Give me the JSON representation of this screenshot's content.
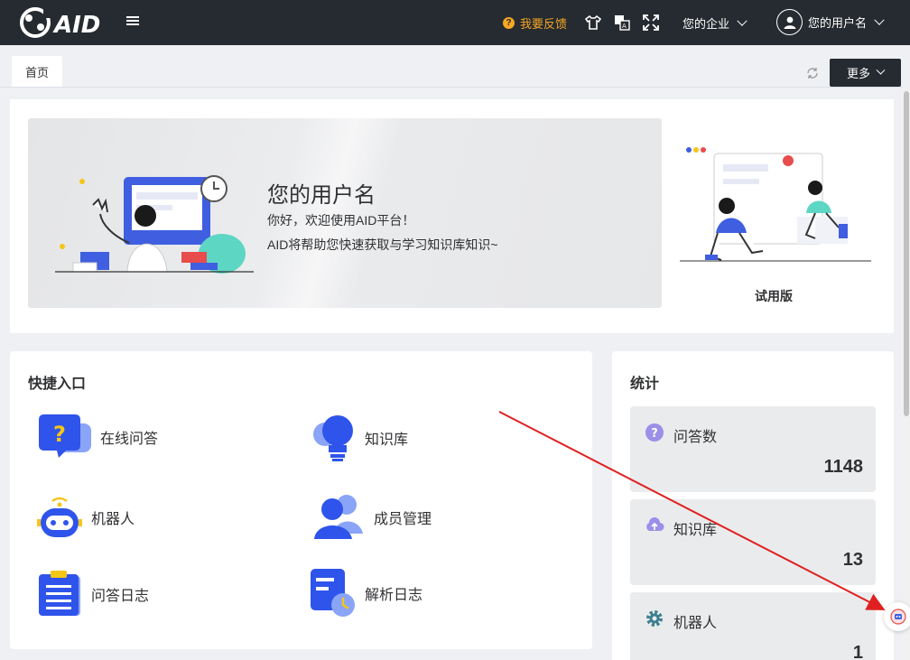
{
  "header": {
    "logo_text": "AID",
    "feedback_label": "我要反馈",
    "enterprise_label": "您的企业",
    "user_label": "您的用户名"
  },
  "tabs": {
    "home_label": "首页",
    "more_label": "更多"
  },
  "welcome": {
    "name": "您的用户名",
    "line1": "你好，欢迎使用AID平台！",
    "line2": "AID将帮助您快速获取与学习知识库知识~",
    "plan_label": "试用版"
  },
  "quick_entry": {
    "title": "快捷入口",
    "items": [
      {
        "label": "在线问答",
        "icon": "chat-question-icon"
      },
      {
        "label": "知识库",
        "icon": "lightbulb-icon"
      },
      {
        "label": "机器人",
        "icon": "robot-icon"
      },
      {
        "label": "成员管理",
        "icon": "members-icon"
      },
      {
        "label": "问答日志",
        "icon": "clipboard-icon"
      },
      {
        "label": "解析日志",
        "icon": "document-clock-icon"
      }
    ]
  },
  "stats": {
    "title": "统计",
    "items": [
      {
        "label": "问答数",
        "value": "1148",
        "icon": "question-circle-icon"
      },
      {
        "label": "知识库",
        "value": "13",
        "icon": "cloud-upload-icon"
      },
      {
        "label": "机器人",
        "value": "1",
        "icon": "gear-icon"
      }
    ]
  },
  "colors": {
    "topbar": "#262b31",
    "accent_orange": "#f5a623",
    "icon_blue": "#2f54eb",
    "stat_purple": "#9b8fe8",
    "annotation_red": "#e02020"
  }
}
